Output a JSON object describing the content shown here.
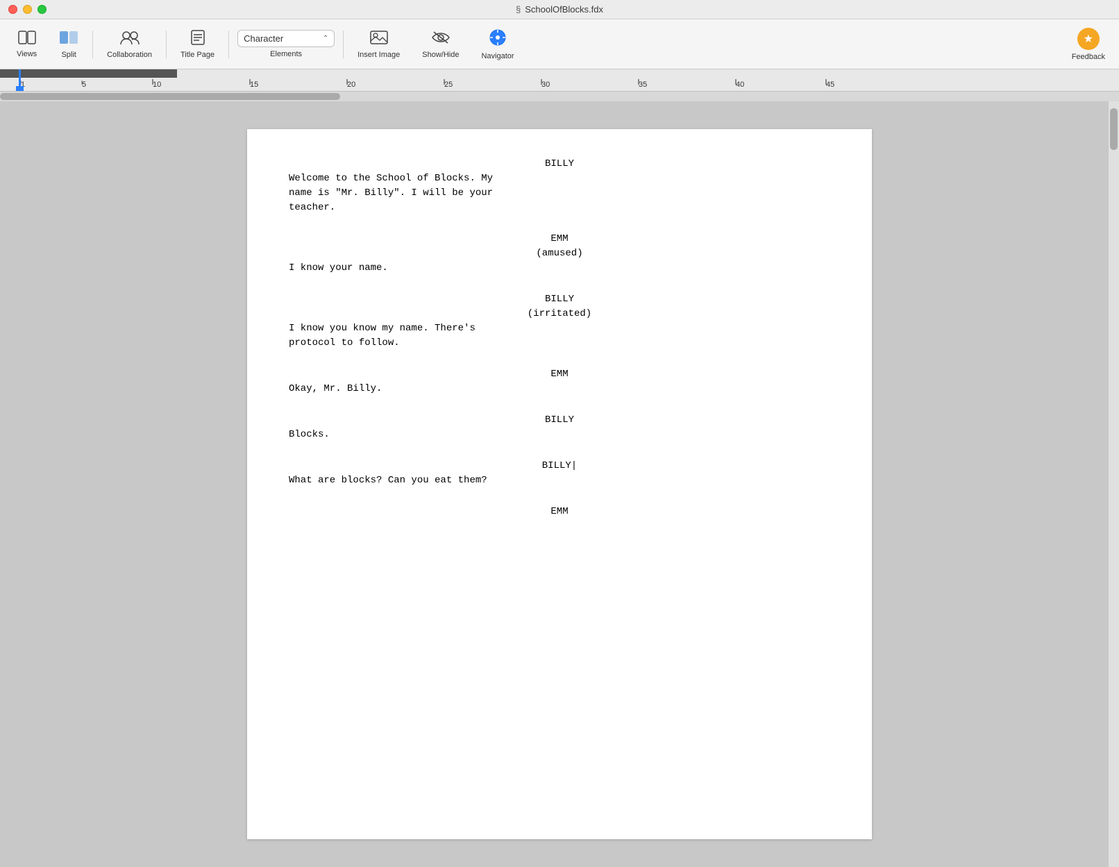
{
  "titlebar": {
    "icon": "§",
    "title": "SchoolOfBlocks.fdx"
  },
  "toolbar": {
    "views_label": "Views",
    "split_label": "Split",
    "collaboration_label": "Collaboration",
    "title_page_label": "Title Page",
    "elements_label": "Elements",
    "elements_value": "Character",
    "insert_image_label": "Insert Image",
    "show_hide_label": "Show/Hide",
    "navigator_label": "Navigator",
    "feedback_label": "Feedback"
  },
  "ruler": {
    "marks": [
      "1",
      "5",
      "10",
      "15",
      "20",
      "25",
      "30",
      "35",
      "40",
      "45"
    ]
  },
  "screenplay": [
    {
      "type": "character",
      "name": "BILLY",
      "parenthetical": null,
      "dialogue": "Welcome to the School of Blocks. My\nname is \"Mr. Billy\". I will be your\nteacher."
    },
    {
      "type": "character",
      "name": "EMM",
      "parenthetical": "(amused)",
      "dialogue": "I know your name."
    },
    {
      "type": "character",
      "name": "BILLY",
      "parenthetical": "(irritated)",
      "dialogue": "I know you know my name. There's\nprotocol to follow."
    },
    {
      "type": "character",
      "name": "EMM",
      "parenthetical": null,
      "dialogue": "Okay, Mr. Billy."
    },
    {
      "type": "character",
      "name": "BILLY",
      "parenthetical": null,
      "dialogue": "Blocks."
    },
    {
      "type": "character",
      "name": "BILLY",
      "cursor": true,
      "parenthetical": null,
      "dialogue": "What are blocks? Can you eat them?"
    },
    {
      "type": "character",
      "name": "EMM",
      "partial": true,
      "parenthetical": null,
      "dialogue": null
    }
  ]
}
